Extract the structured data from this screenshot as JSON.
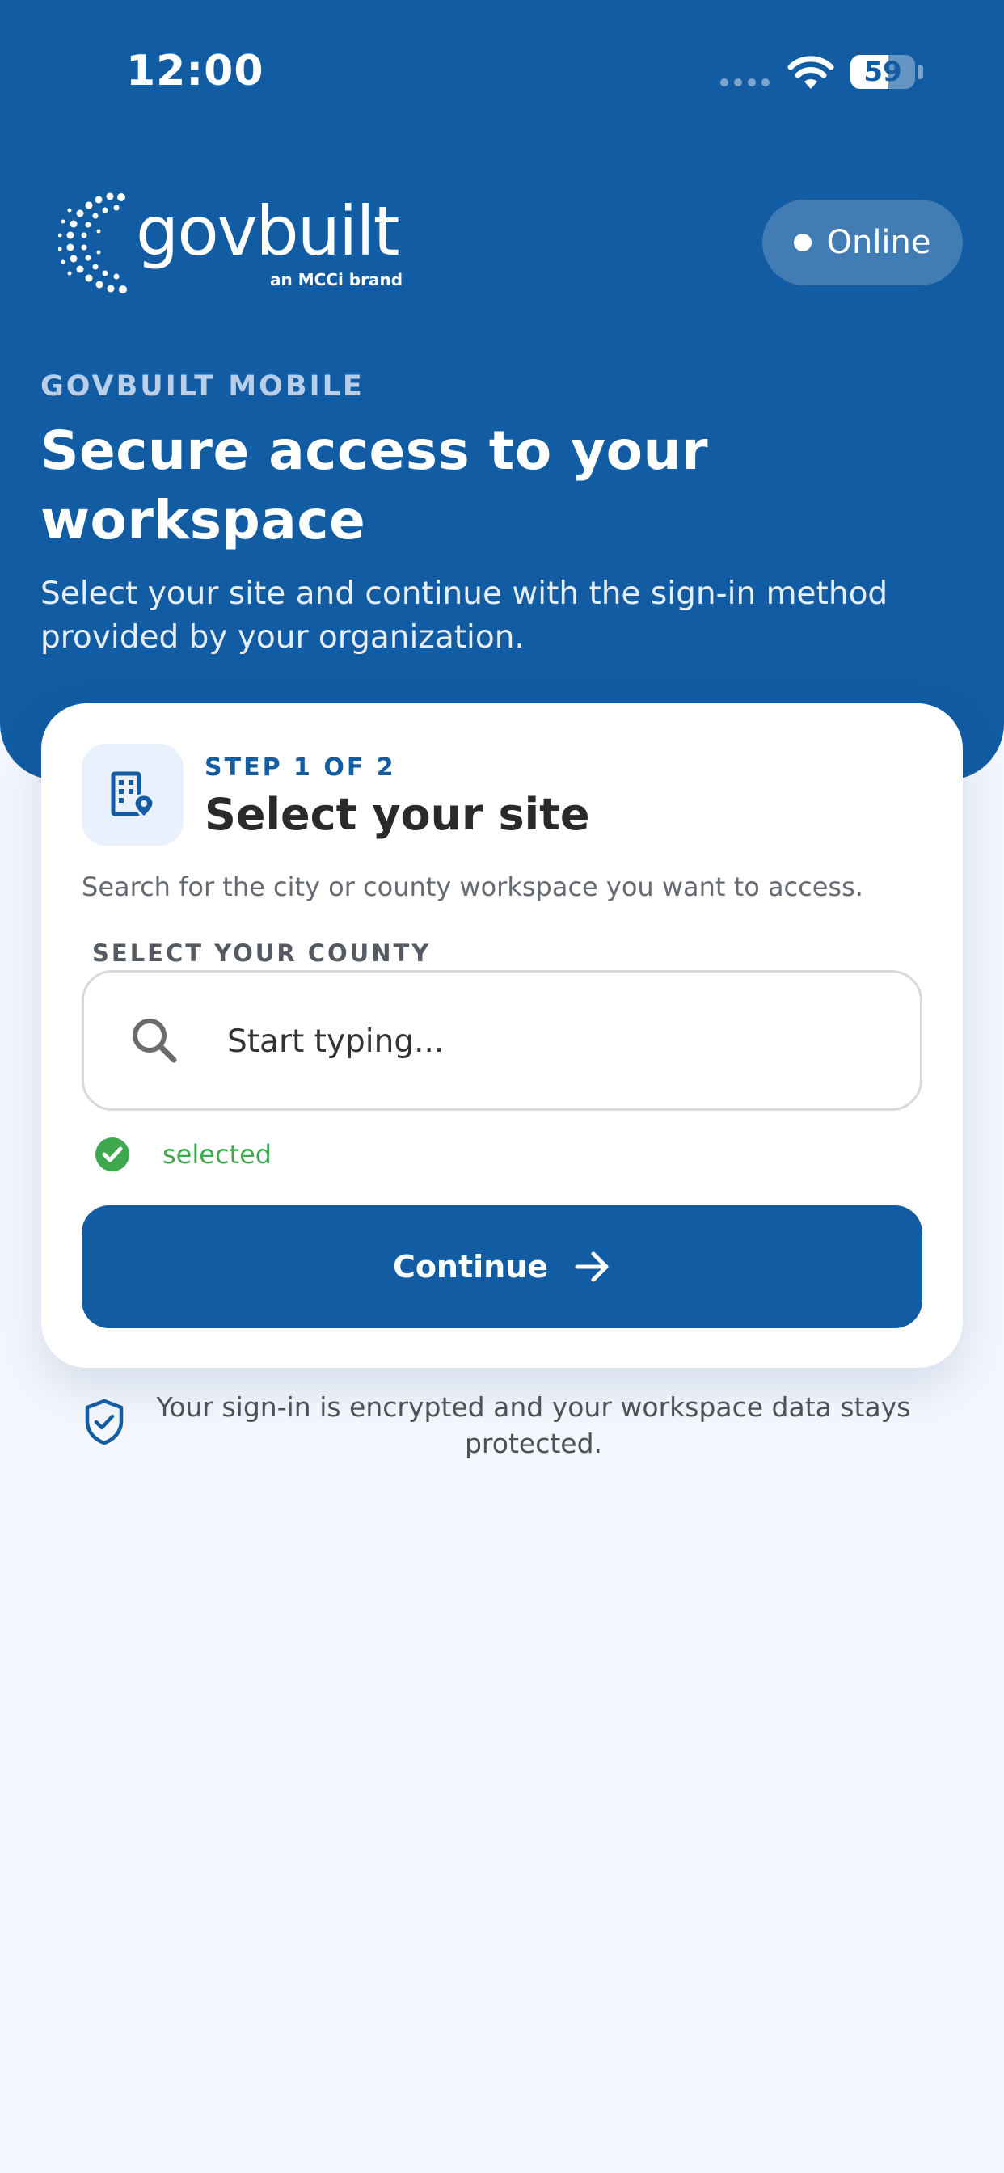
{
  "status_bar": {
    "time": "12:00",
    "battery_percent": 59,
    "battery_label": "59",
    "icons": [
      "cellular-signal-icon",
      "wifi-icon",
      "battery-icon"
    ]
  },
  "brand": {
    "name": "govbuilt",
    "tagline": "an MCCi brand"
  },
  "connection": {
    "label": "Online"
  },
  "hero": {
    "eyebrow": "GOVBUILT MOBILE",
    "title": "Secure access to your workspace",
    "subtitle": "Select your site and continue with the sign-in method provided by your organization."
  },
  "card": {
    "icon": "building-location-icon",
    "step": "STEP 1 OF 2",
    "title": "Select your site",
    "description": "Search for the city or county workspace you want to access.",
    "field_label": "SELECT YOUR COUNTY",
    "search": {
      "placeholder": "Start typing...",
      "value": ""
    },
    "status": "selected",
    "continue_label": "Continue"
  },
  "footer": {
    "note": "Your sign-in is encrypted and your workspace data stays protected."
  },
  "colors": {
    "primary": "#125ca3",
    "background": "#f4f7fd",
    "success": "#3ea84e",
    "card": "#ffffff"
  }
}
